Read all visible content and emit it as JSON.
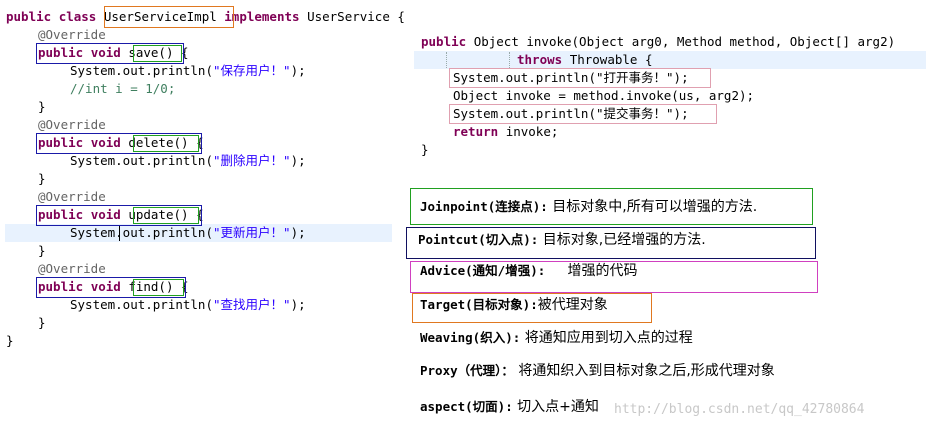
{
  "left_code": {
    "class_decl": {
      "kw1": "public",
      "kw2": "class",
      "name": "UserServiceImpl",
      "kw3": "implements",
      "iface": "UserService",
      "brace": "{"
    },
    "methods": [
      {
        "annotation": "@Override",
        "mod": "public",
        "type": "void",
        "name": "save()",
        "open": "{",
        "body1_prefix": "System.out.println(",
        "body1_string": "\"保存用户！\"",
        "body1_suffix": ");",
        "body2": "//int i = 1/0;",
        "close": "}"
      },
      {
        "annotation": "@Override",
        "mod": "public",
        "type": "void",
        "name": "delete()",
        "open": "{",
        "body1_prefix": "System.out.println(",
        "body1_string": "\"删除用户！\"",
        "body1_suffix": ");",
        "close": "}"
      },
      {
        "annotation": "@Override",
        "mod": "public",
        "type": "void",
        "name": "update()",
        "open": "{",
        "body1_prefix": "System.out.println(",
        "body1_string": "\"更新用户！\"",
        "body1_suffix": ");",
        "close": "}"
      },
      {
        "annotation": "@Override",
        "mod": "public",
        "type": "void",
        "name": "find()",
        "open": "{",
        "body1_prefix": "System.out.println(",
        "body1_string": "\"查找用户！\"",
        "body1_suffix": ");",
        "close": "}"
      }
    ],
    "class_close": "}"
  },
  "right_code": {
    "sig_kw": "public",
    "sig_rest": "Object invoke(Object arg0, Method method, Object[] arg2)",
    "throws_kw": "throws",
    "throws_rest": "Throwable {",
    "line1": "System.out.println(\"打开事务！\");",
    "line2": "Object invoke = method.invoke(us, arg2);",
    "line3": "System.out.println(\"提交事务！\");",
    "ret_kw": "return",
    "ret_rest": "invoke;",
    "close": "}"
  },
  "definitions": [
    {
      "term": "Joinpoint(连接点):",
      "desc": " 目标对象中,所有可以增强的方法."
    },
    {
      "term": "Pointcut(切入点):",
      "desc": " 目标对象,已经增强的方法."
    },
    {
      "term": "Advice(通知/增强):",
      "desc": "     增强的代码"
    },
    {
      "term": "Target(目标对象):",
      "desc": "被代理对象"
    },
    {
      "term": "Weaving(织入):",
      "desc": " 将通知应用到切入点的过程"
    },
    {
      "term": "Proxy（代理）：",
      "desc": " 将通知织入到目标对象之后,形成代理对象"
    },
    {
      "term": "aspect(切面):",
      "desc": " 切入点+通知"
    }
  ],
  "watermark": "http://blog.csdn.net/qq_42780864",
  "colors": {
    "keyword": "#7f0055",
    "string": "#2a00ff",
    "comment": "#3f7f5f",
    "annotation": "#646464",
    "orange_box": "#e07820",
    "blue_box": "#1a1aa8",
    "green_box": "#20a020",
    "pink_box": "#e0a0b0",
    "magenta_box": "#d040c0",
    "navy_box": "#101060"
  }
}
